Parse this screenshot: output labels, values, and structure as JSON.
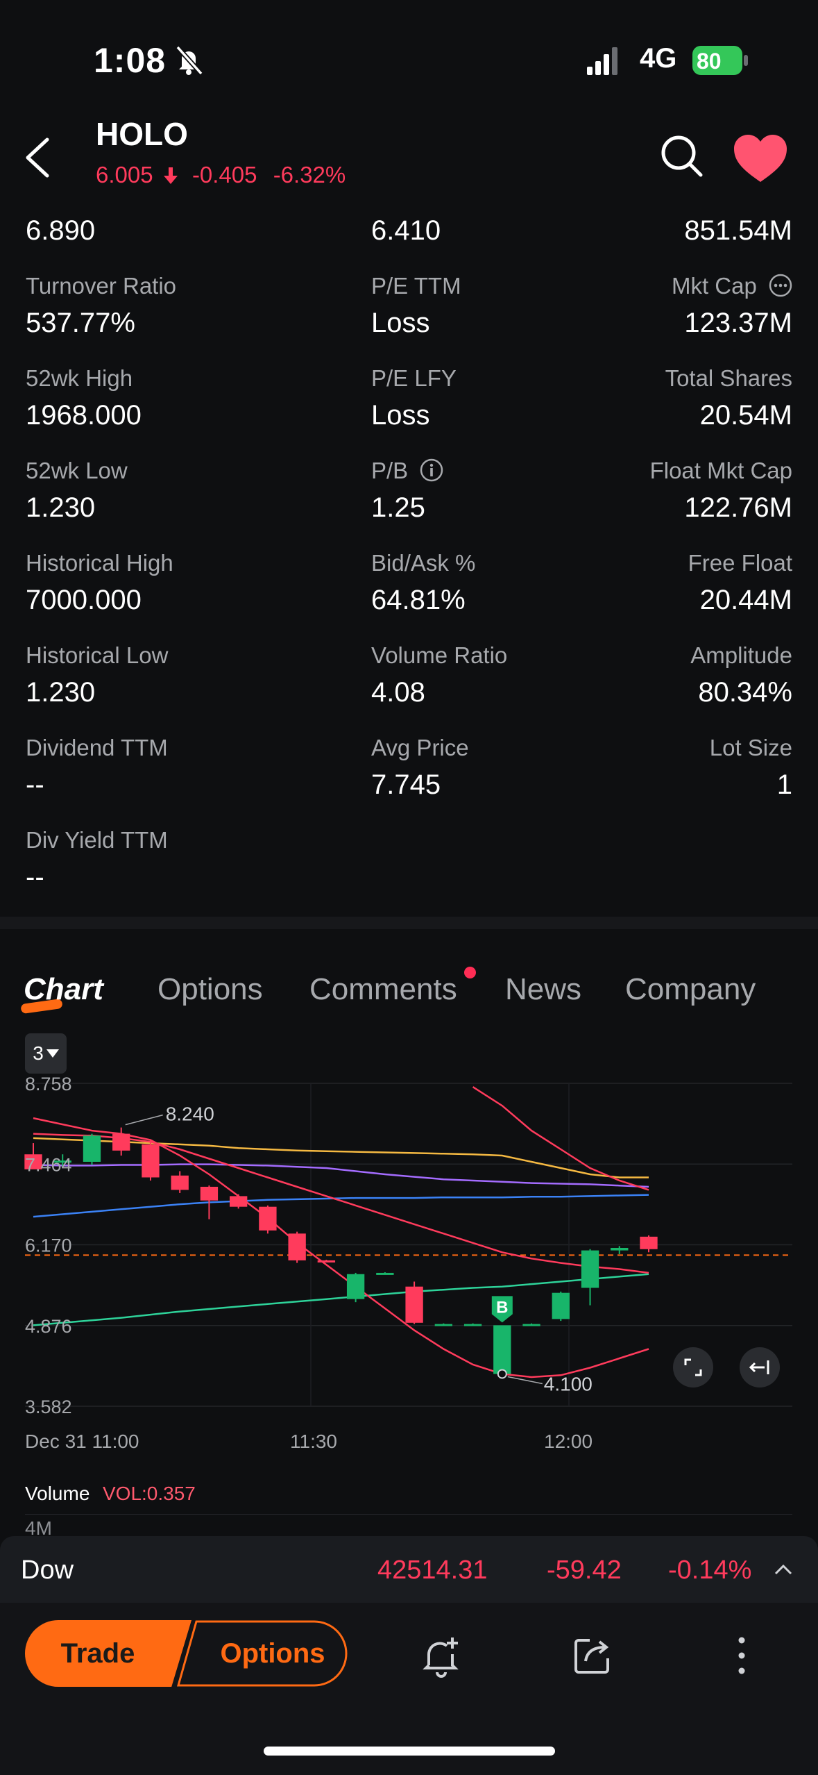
{
  "status_bar": {
    "time": "1:08",
    "network": "4G",
    "battery": "80"
  },
  "header": {
    "ticker": "HOLO",
    "price": "6.005",
    "change": "-0.405",
    "change_pct": "-6.32%"
  },
  "stats": {
    "top_row": [
      "6.890",
      "6.410",
      "851.54M"
    ],
    "rows": [
      [
        {
          "label": "Turnover Ratio",
          "value": "537.77%"
        },
        {
          "label": "P/E TTM",
          "value": "Loss"
        },
        {
          "label": "Mkt Cap",
          "value": "123.37M"
        }
      ],
      [
        {
          "label": "52wk High",
          "value": "1968.000"
        },
        {
          "label": "P/E LFY",
          "value": "Loss"
        },
        {
          "label": "Total Shares",
          "value": "20.54M"
        }
      ],
      [
        {
          "label": "52wk Low",
          "value": "1.230"
        },
        {
          "label": "P/B",
          "value": "1.25"
        },
        {
          "label": "Float Mkt Cap",
          "value": "122.76M"
        }
      ],
      [
        {
          "label": "Historical High",
          "value": "7000.000"
        },
        {
          "label": "Bid/Ask %",
          "value": "64.81%"
        },
        {
          "label": "Free Float",
          "value": "20.44M"
        }
      ],
      [
        {
          "label": "Historical Low",
          "value": "1.230"
        },
        {
          "label": "Volume Ratio",
          "value": "4.08"
        },
        {
          "label": "Amplitude",
          "value": "80.34%"
        }
      ],
      [
        {
          "label": "Dividend TTM",
          "value": "--"
        },
        {
          "label": "Avg Price",
          "value": "7.745"
        },
        {
          "label": "Lot Size",
          "value": "1"
        }
      ],
      [
        {
          "label": "Div Yield TTM",
          "value": "--"
        }
      ]
    ]
  },
  "tabs": [
    "Chart",
    "Options",
    "Comments",
    "News",
    "Company"
  ],
  "chart": {
    "period": "3",
    "high_label": "8.240",
    "low_label": "4.100",
    "buy_marker": "B",
    "x_ticks": [
      "Dec 31 11:00",
      "11:30",
      "12:00"
    ]
  },
  "chart_data": {
    "type": "candlestick",
    "y_ticks": [
      8.758,
      7.464,
      6.17,
      4.876,
      3.582
    ],
    "ylim": [
      3.582,
      8.758
    ],
    "x_ticks": [
      "Dec 31 11:00",
      "11:30",
      "12:00"
    ],
    "reference_price": 6.005,
    "candles": [
      {
        "open": 7.62,
        "high": 7.8,
        "low": 7.4,
        "close": 7.38
      },
      {
        "open": 7.5,
        "high": 7.62,
        "low": 7.42,
        "close": 7.52
      },
      {
        "open": 7.5,
        "high": 7.95,
        "low": 7.45,
        "close": 7.92
      },
      {
        "open": 7.95,
        "high": 8.05,
        "low": 7.6,
        "close": 7.68
      },
      {
        "open": 7.78,
        "high": 7.85,
        "low": 7.2,
        "close": 7.25
      },
      {
        "open": 7.28,
        "high": 7.35,
        "low": 7.0,
        "close": 7.05
      },
      {
        "open": 7.1,
        "high": 7.12,
        "low": 6.58,
        "close": 6.88
      },
      {
        "open": 6.95,
        "high": 6.98,
        "low": 6.75,
        "close": 6.78
      },
      {
        "open": 6.78,
        "high": 6.8,
        "low": 6.35,
        "close": 6.4
      },
      {
        "open": 6.35,
        "high": 6.38,
        "low": 5.88,
        "close": 5.92
      },
      {
        "open": 5.92,
        "high": 5.93,
        "low": 5.91,
        "close": 5.91
      },
      {
        "open": 5.3,
        "high": 5.72,
        "low": 5.25,
        "close": 5.7
      },
      {
        "open": 5.72,
        "high": 5.73,
        "low": 5.71,
        "close": 5.72
      },
      {
        "open": 5.5,
        "high": 5.58,
        "low": 4.9,
        "close": 4.92
      },
      {
        "open": 4.9,
        "high": 4.91,
        "low": 4.89,
        "close": 4.9
      },
      {
        "open": 4.9,
        "high": 4.91,
        "low": 4.89,
        "close": 4.9
      },
      {
        "open": 4.1,
        "high": 4.86,
        "low": 4.1,
        "close": 4.88
      },
      {
        "open": 4.9,
        "high": 4.91,
        "low": 4.89,
        "close": 4.9
      },
      {
        "open": 4.98,
        "high": 5.42,
        "low": 4.95,
        "close": 5.4
      },
      {
        "open": 5.48,
        "high": 6.1,
        "low": 5.2,
        "close": 6.08
      },
      {
        "open": 6.08,
        "high": 6.15,
        "low": 6.02,
        "close": 6.12
      },
      {
        "open": 6.3,
        "high": 6.32,
        "low": 6.05,
        "close": 6.1
      }
    ],
    "lines": [
      {
        "color": "#f5b942",
        "values": [
          7.88,
          7.86,
          7.84,
          7.82,
          7.8,
          7.78,
          7.76,
          7.72,
          7.7,
          7.68,
          7.67,
          7.66,
          7.65,
          7.64,
          7.63,
          7.62,
          7.6,
          7.5,
          7.4,
          7.3,
          7.25,
          7.25
        ]
      },
      {
        "color": "#a46cff",
        "values": [
          7.45,
          7.44,
          7.44,
          7.45,
          7.45,
          7.46,
          7.46,
          7.45,
          7.44,
          7.42,
          7.4,
          7.35,
          7.3,
          7.26,
          7.22,
          7.2,
          7.18,
          7.16,
          7.15,
          7.14,
          7.12,
          7.1
        ]
      },
      {
        "color": "#3b82f6",
        "values": [
          6.62,
          6.66,
          6.7,
          6.74,
          6.78,
          6.82,
          6.85,
          6.87,
          6.89,
          6.9,
          6.91,
          6.92,
          6.92,
          6.92,
          6.93,
          6.93,
          6.93,
          6.94,
          6.94,
          6.95,
          6.96,
          6.97
        ]
      },
      {
        "color": "#2ed39a",
        "values": [
          4.88,
          4.92,
          4.96,
          5.0,
          5.05,
          5.1,
          5.14,
          5.18,
          5.22,
          5.26,
          5.3,
          5.34,
          5.38,
          5.42,
          5.45,
          5.48,
          5.5,
          5.54,
          5.58,
          5.62,
          5.66,
          5.7
        ]
      },
      {
        "color": "#ff3b5c",
        "values": [
          8.2,
          8.1,
          8.0,
          7.95,
          7.85,
          7.6,
          7.3,
          6.95,
          6.6,
          6.2,
          5.85,
          5.5,
          5.15,
          4.8,
          4.5,
          4.25,
          4.1,
          4.05,
          4.08,
          4.2,
          4.35,
          4.5
        ]
      },
      {
        "color": "#ff3b5c",
        "values": [
          7.95,
          7.93,
          7.92,
          7.88,
          7.82,
          7.7,
          7.55,
          7.4,
          7.25,
          7.1,
          6.95,
          6.8,
          6.65,
          6.5,
          6.35,
          6.2,
          6.05,
          5.95,
          5.88,
          5.82,
          5.78,
          5.72
        ]
      },
      {
        "color": "#ff3b5c",
        "values": [
          null,
          null,
          null,
          null,
          null,
          null,
          null,
          null,
          null,
          null,
          null,
          null,
          null,
          null,
          null,
          8.7,
          8.4,
          8.0,
          7.7,
          7.4,
          7.2,
          7.05
        ]
      }
    ]
  },
  "volume": {
    "label": "Volume",
    "value": "VOL:0.357",
    "axis": "4M"
  },
  "index_bar": {
    "name": "Dow",
    "price": "42514.31",
    "change": "-59.42",
    "change_pct": "-0.14%"
  },
  "bottom_bar": {
    "trade": "Trade",
    "options": "Options"
  },
  "colors": {
    "accent": "#ff6a13",
    "down": "#ff3b5c",
    "up": "#18b56a",
    "background": "#0e0f11"
  }
}
